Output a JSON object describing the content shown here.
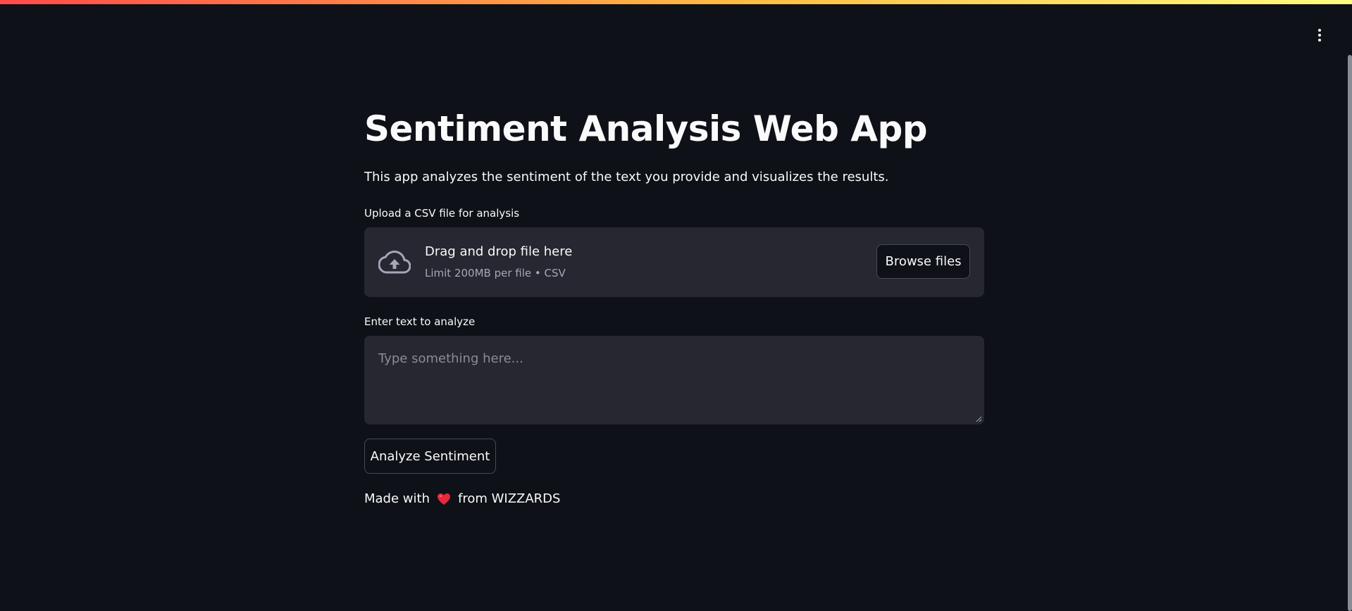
{
  "app": {
    "title": "Sentiment Analysis Web App",
    "description": "This app analyzes the sentiment of the text you provide and visualizes the results."
  },
  "uploader": {
    "label": "Upload a CSV file for analysis",
    "drop_text": "Drag and drop file here",
    "limit_text": "Limit 200MB per file • CSV",
    "browse_label": "Browse files",
    "icon": "cloud-upload-icon"
  },
  "text_input": {
    "label": "Enter text to analyze",
    "placeholder": "Type something here...",
    "value": ""
  },
  "actions": {
    "analyze_label": "Analyze Sentiment"
  },
  "footer": {
    "prefix": "Made with",
    "icon": "heart-icon",
    "suffix": "from WIZZARDS"
  },
  "header": {
    "menu_icon": "kebab-menu-icon"
  },
  "colors": {
    "background": "#0e1117",
    "surface": "#262730",
    "text": "#fafafa",
    "muted_text": "#a3a8b8",
    "heart": "#e8293a",
    "accent_gradient_start": "#ff4b4b",
    "accent_gradient_end": "#fffd80"
  }
}
